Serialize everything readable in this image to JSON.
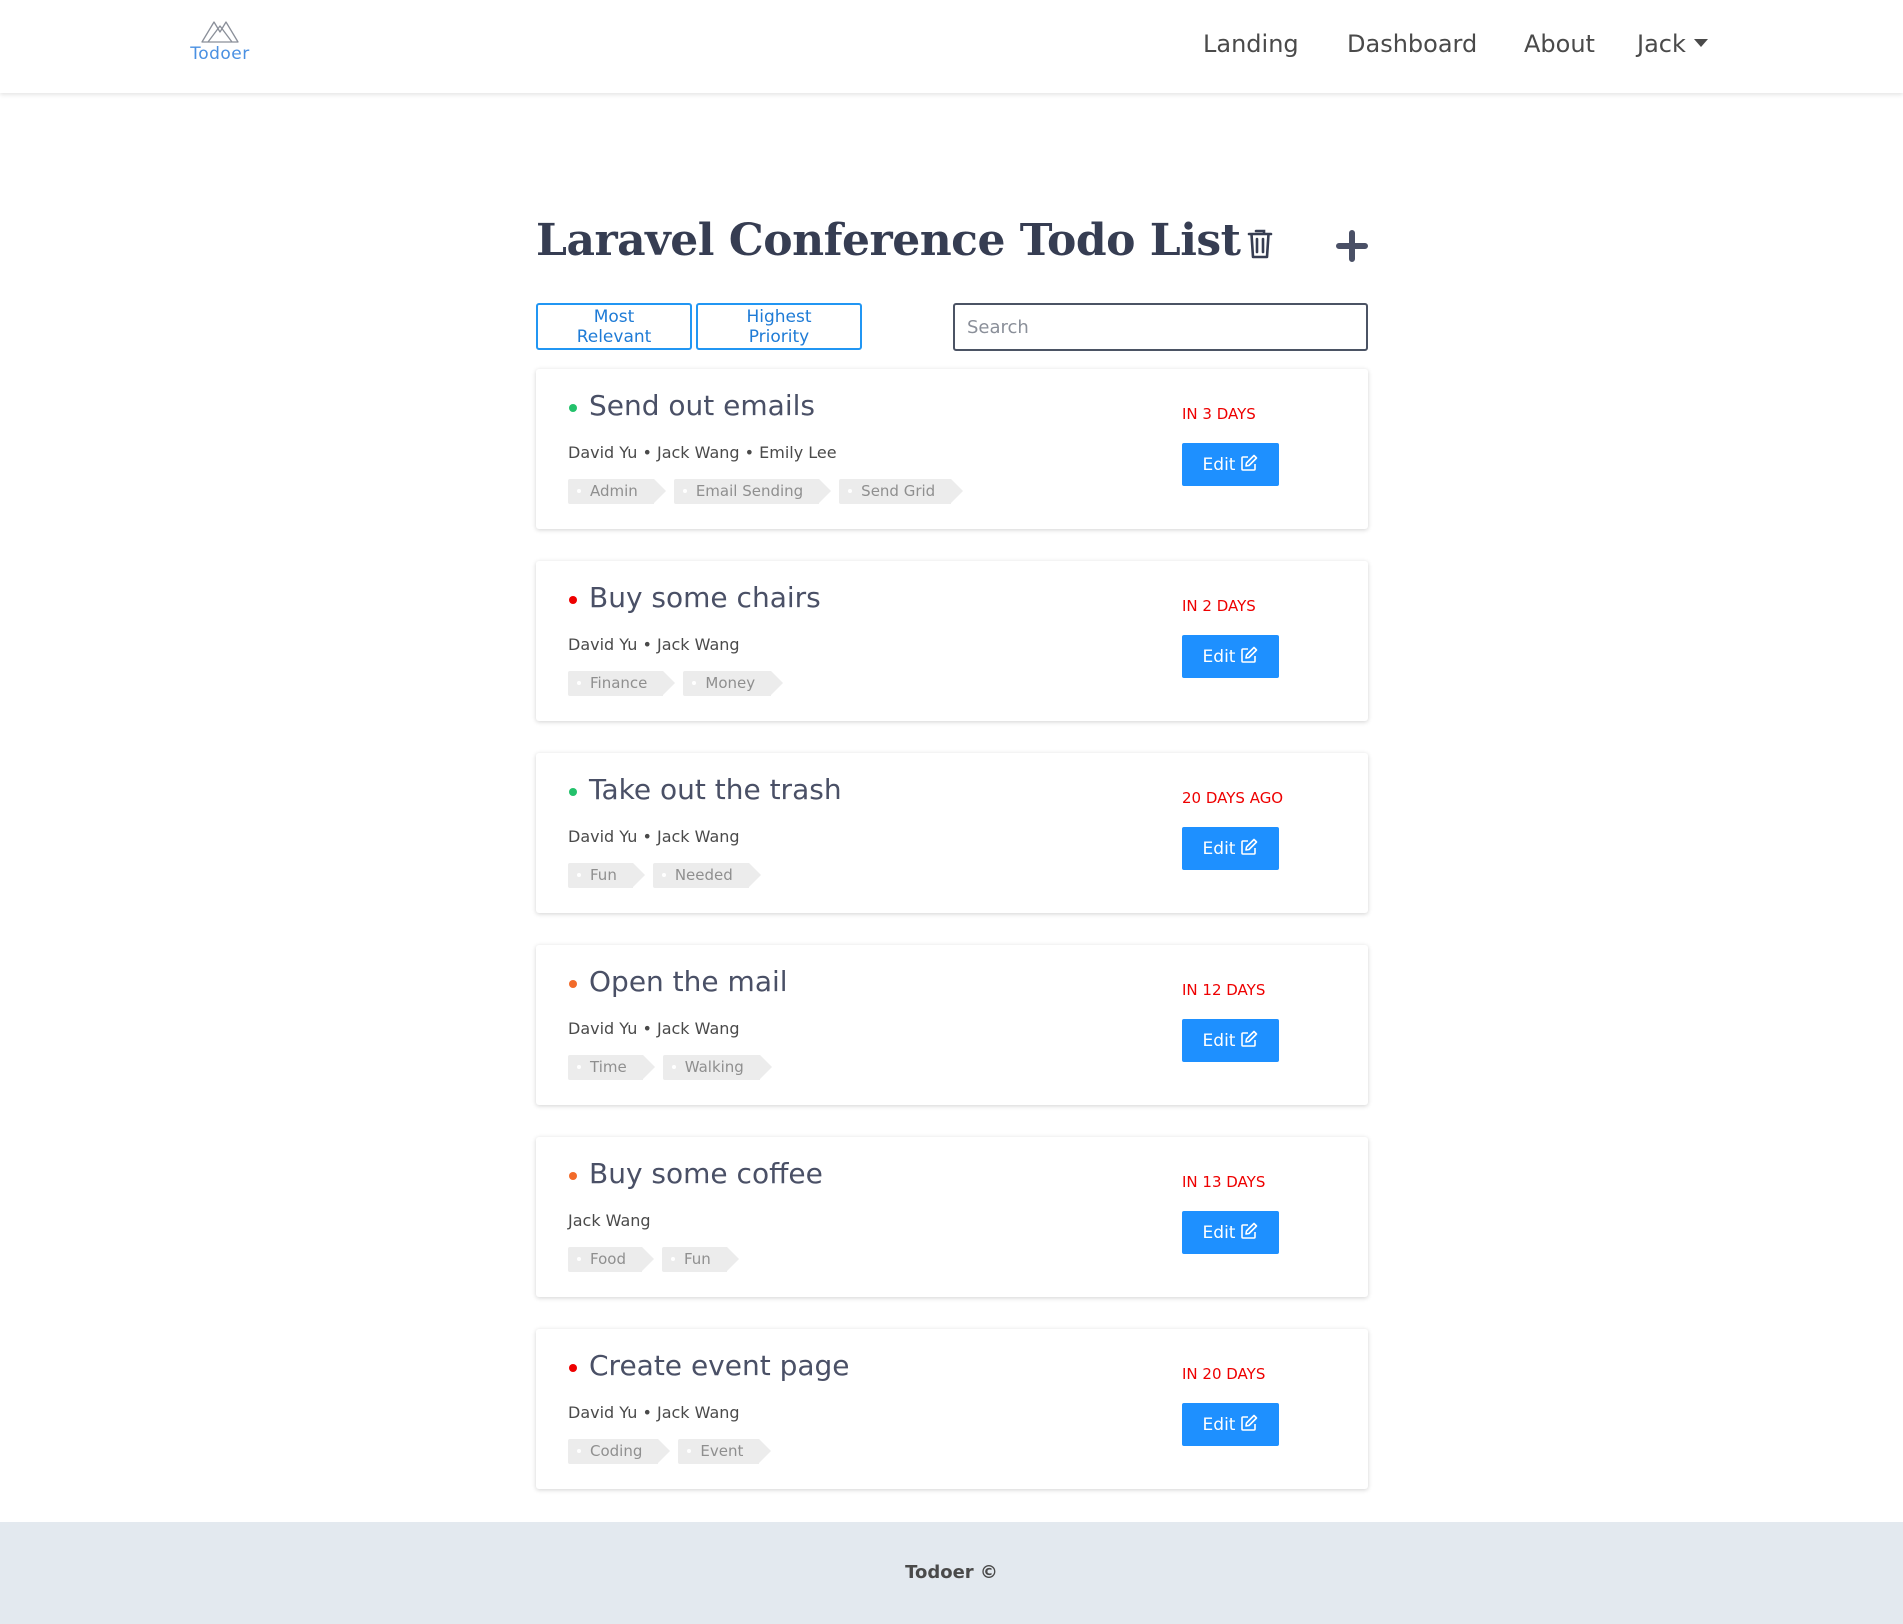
{
  "navbar": {
    "brand": "Todoer",
    "links": {
      "landing": "Landing",
      "dashboard": "Dashboard",
      "about": "About",
      "user": "Jack"
    }
  },
  "page": {
    "title": "Laravel Conference Todo List"
  },
  "controls": {
    "most_relevant": "Most Relevant",
    "highest_priority": "Highest Priority",
    "search_placeholder": "Search",
    "search_value": ""
  },
  "colors": {
    "priority_low": "#23c16b",
    "priority_medium": "#f26b2a",
    "priority_high": "#ee0000",
    "accent": "#1e90ff"
  },
  "todos": [
    {
      "title": "Send out emails",
      "priority": "low",
      "assignees": "David Yu • Jack Wang • Emily Lee",
      "tags": [
        "Admin",
        "Email Sending",
        "Send Grid"
      ],
      "due": "IN 3 DAYS",
      "edit_label": "Edit"
    },
    {
      "title": "Buy some chairs",
      "priority": "high",
      "assignees": "David Yu • Jack Wang",
      "tags": [
        "Finance",
        "Money"
      ],
      "due": "IN 2 DAYS",
      "edit_label": "Edit"
    },
    {
      "title": "Take out the trash",
      "priority": "low",
      "assignees": "David Yu • Jack Wang",
      "tags": [
        "Fun",
        "Needed"
      ],
      "due": "20 DAYS AGO",
      "edit_label": "Edit"
    },
    {
      "title": "Open the mail",
      "priority": "medium",
      "assignees": "David Yu • Jack Wang",
      "tags": [
        "Time",
        "Walking"
      ],
      "due": "IN 12 DAYS",
      "edit_label": "Edit"
    },
    {
      "title": "Buy some coffee",
      "priority": "medium",
      "assignees": "Jack Wang",
      "tags": [
        "Food",
        "Fun"
      ],
      "due": "IN 13 DAYS",
      "edit_label": "Edit"
    },
    {
      "title": "Create event page",
      "priority": "high",
      "assignees": "David Yu • Jack Wang",
      "tags": [
        "Coding",
        "Event"
      ],
      "due": "IN 20 DAYS",
      "edit_label": "Edit"
    }
  ],
  "footer": {
    "text": "Todoer ©"
  }
}
